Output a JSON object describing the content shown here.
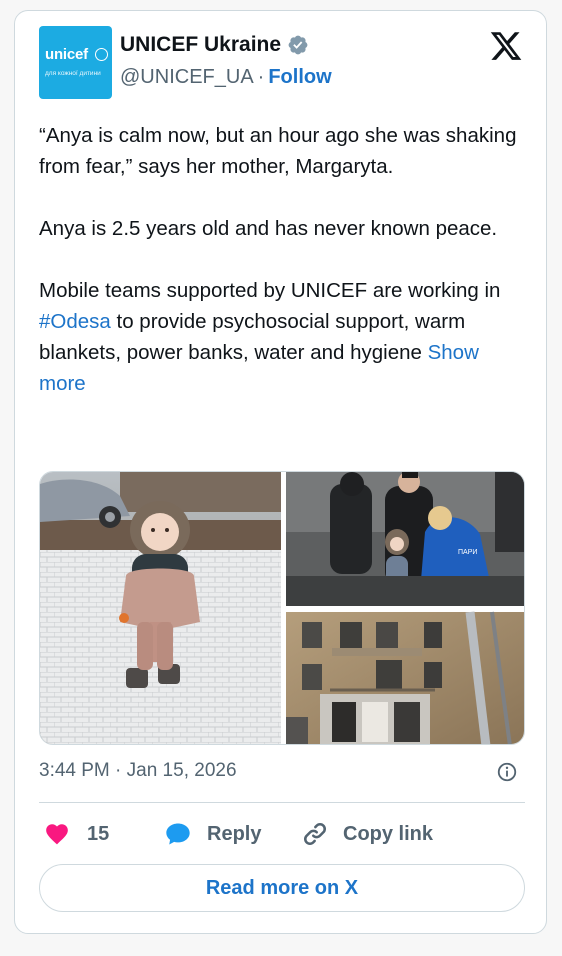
{
  "account": {
    "name": "UNICEF Ukraine",
    "handle": "@UNICEF_UA",
    "separator": "·",
    "follow_label": "Follow",
    "avatar_brand": "unicef",
    "avatar_tagline": "для кожної дитини",
    "avatar_color": "#1cabe2",
    "verified_badge_color": "#829aab"
  },
  "tweet": {
    "paragraph1": "“Anya is calm now, but an hour ago she was shaking from fear,” says her mother, Margaryta.",
    "paragraph2": "Anya is 2.5 years old and has never known peace.",
    "paragraph3_before": "Mobile teams supported by UNICEF are working in ",
    "hashtag": "#Odesa",
    "paragraph3_after": " to provide psychosocial support, warm blankets, power banks, water and hygiene ",
    "show_more_label": "Show more",
    "timestamp": "3:44 PM · Jan 15, 2026"
  },
  "media": {
    "photos": [
      {
        "name": "child-in-snowsuit-photo"
      },
      {
        "name": "volunteers-with-child-photo"
      },
      {
        "name": "damaged-building-photo"
      }
    ],
    "vest_text": "ПАРИ"
  },
  "actions": {
    "like_count": "15",
    "reply_label": "Reply",
    "copy_link_label": "Copy link",
    "read_more_label": "Read more on X"
  },
  "colors": {
    "link": "#1d74c9",
    "like": "#f91880",
    "muted": "#536471",
    "border": "#cfd9de"
  }
}
